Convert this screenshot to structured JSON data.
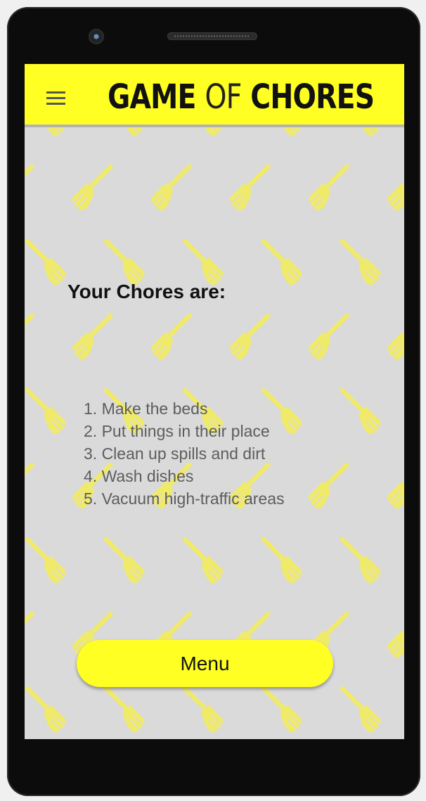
{
  "app": {
    "logo_part1": "GAME",
    "logo_part2": "OF",
    "logo_part3": "CHORES",
    "menu_icon": "hamburger-menu-icon"
  },
  "content": {
    "heading": "Your Chores are:",
    "chores": [
      "1. Make the beds",
      "2. Put things in their place",
      "3. Clean up spills and dirt",
      "4. Wash dishes",
      "5. Vacuum high-traffic areas"
    ],
    "menu_button_label": "Menu"
  },
  "colors": {
    "appbar": "#ffff24",
    "background": "#dadada",
    "pattern": "#f0ea6a",
    "button": "#ffff24"
  },
  "background_icon": "broom-icon"
}
